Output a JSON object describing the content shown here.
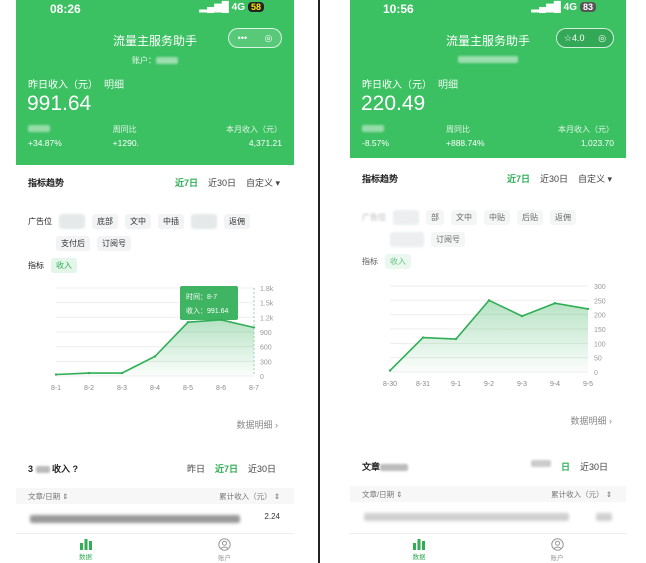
{
  "colors": {
    "brand_green": "#3bc062",
    "accent_green": "#2fae55",
    "divider": "#222222"
  },
  "left": {
    "status": {
      "time": "08:26",
      "network": "4G",
      "battery": "58"
    },
    "title": "流量主服务助手",
    "account_label": "账户：",
    "yesterday_label": "昨日收入（元）",
    "detail_link": "明细",
    "big_value": "991.64",
    "stats": [
      {
        "label": "",
        "value": "+34.87%"
      },
      {
        "label": "周同比",
        "value": "+1290."
      },
      {
        "label": "本月收入（元）",
        "value": "4,371.21"
      }
    ],
    "trend": {
      "title": "指标趋势",
      "options": [
        "近7日",
        "近30日",
        "自定义 ▾"
      ],
      "active": 0
    },
    "ad_row_label": "广告位",
    "ad_chips": [
      "",
      "底部",
      "文中",
      "中插",
      "",
      "返佣",
      "支付后",
      "订阅号"
    ],
    "metric_label": "指标",
    "metric_chip": "收入",
    "more_link": "数据明细 ›",
    "section2": {
      "title": "3",
      "suffix": "收入 ?",
      "options": [
        "昨日",
        "近7日",
        "近30日"
      ],
      "active": 1
    },
    "table": {
      "col1": "文章/日期 ⇕",
      "col2": "累计收入（元） ⇕",
      "first_value": "2.24"
    },
    "tabs": [
      {
        "label": "数据"
      },
      {
        "label": "账户"
      }
    ]
  },
  "right": {
    "status": {
      "time": "10:56",
      "network": "4G",
      "battery": "83"
    },
    "title": "流量主服务助手",
    "capsule_rating": "☆4.0",
    "yesterday_label": "昨日收入（元）",
    "detail_link": "明细",
    "big_value": "220.49",
    "stats": [
      {
        "label": "",
        "value": "-8.57%"
      },
      {
        "label": "周同比",
        "value": "+888.74%"
      },
      {
        "label": "本月收入（元）",
        "value": "1,023.70"
      }
    ],
    "trend": {
      "title": "指标趋势",
      "options": [
        "近7日",
        "近30日",
        "自定义 ▾"
      ],
      "active": 0
    },
    "ad_row_label": "广告位",
    "ad_chips": [
      "",
      "",
      "部",
      "文中",
      "中贴",
      "后贴",
      "返佣",
      "",
      "订阅号"
    ],
    "metric_label": "指标",
    "metric_chip": "收入",
    "more_link": "数据明细 ›",
    "section2": {
      "title": "文章",
      "options": [
        "",
        "日",
        "近30日"
      ],
      "active": 1
    },
    "table": {
      "col1": "文章/日期 ⇕",
      "col2": "累计收入（元） ⇕"
    },
    "tabs": [
      {
        "label": "数据"
      },
      {
        "label": "账户"
      }
    ]
  },
  "chart_data": [
    {
      "type": "area",
      "categories": [
        "8-1",
        "8-2",
        "8-3",
        "8-4",
        "8-5",
        "8-6",
        "8-7"
      ],
      "values": [
        30,
        60,
        60,
        400,
        1100,
        1150,
        991.64
      ],
      "y_ticks": [
        "1.8k",
        "1.5k",
        "1.2k",
        "900",
        "600",
        "300",
        "0"
      ],
      "ylim": [
        0,
        1800
      ],
      "tooltip": {
        "time_label": "时间：8-7",
        "value_label": "收入：991.64",
        "index": 6
      }
    },
    {
      "type": "area",
      "categories": [
        "8-30",
        "8-31",
        "9-1",
        "9-2",
        "9-3",
        "9-4",
        "9-5"
      ],
      "values": [
        5,
        120,
        115,
        250,
        195,
        240,
        220
      ],
      "y_ticks": [
        "300",
        "250",
        "200",
        "150",
        "100",
        "50",
        "0"
      ],
      "ylim": [
        0,
        300
      ]
    }
  ]
}
